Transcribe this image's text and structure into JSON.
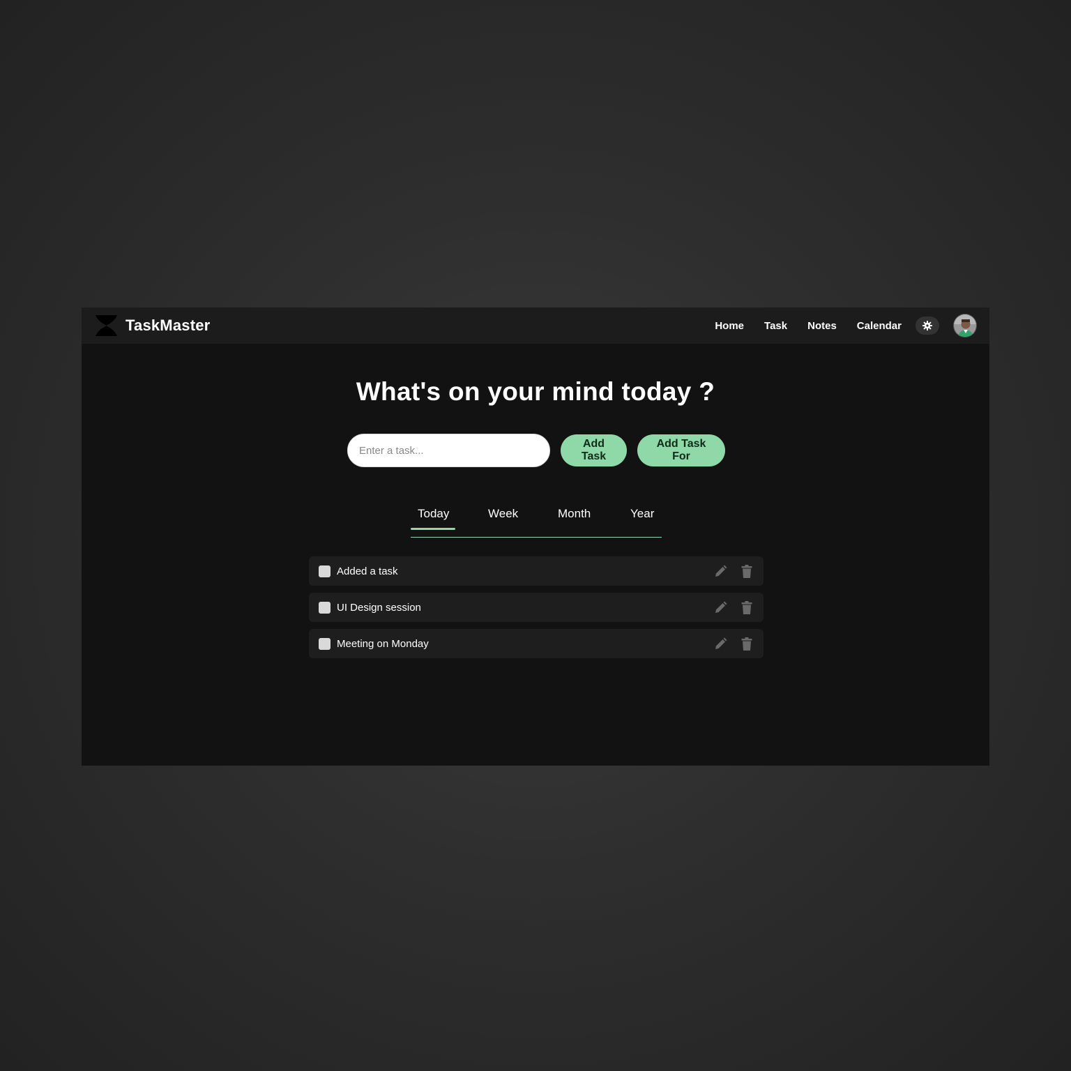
{
  "app": {
    "name": "TaskMaster"
  },
  "nav": {
    "links": [
      "Home",
      "Task",
      "Notes",
      "Calendar"
    ],
    "theme_icon": "gear-icon",
    "avatar_icon": "user-avatar"
  },
  "main": {
    "headline": "What's on your mind today ?",
    "task_input": {
      "placeholder": "Enter a task...",
      "value": ""
    },
    "add_task_label": "Add Task",
    "add_task_for_label": "Add Task For"
  },
  "tabs": {
    "items": [
      "Today",
      "Week",
      "Month",
      "Year"
    ],
    "active": "Today"
  },
  "tasks": [
    {
      "text": "Added a task",
      "checked": false
    },
    {
      "text": "UI Design session",
      "checked": false
    },
    {
      "text": "Meeting on Monday",
      "checked": false
    }
  ],
  "colors": {
    "accent": "#8fd9a8",
    "background": "#121212",
    "navbar": "#1c1c1c",
    "task_row": "#1e1e1e"
  }
}
